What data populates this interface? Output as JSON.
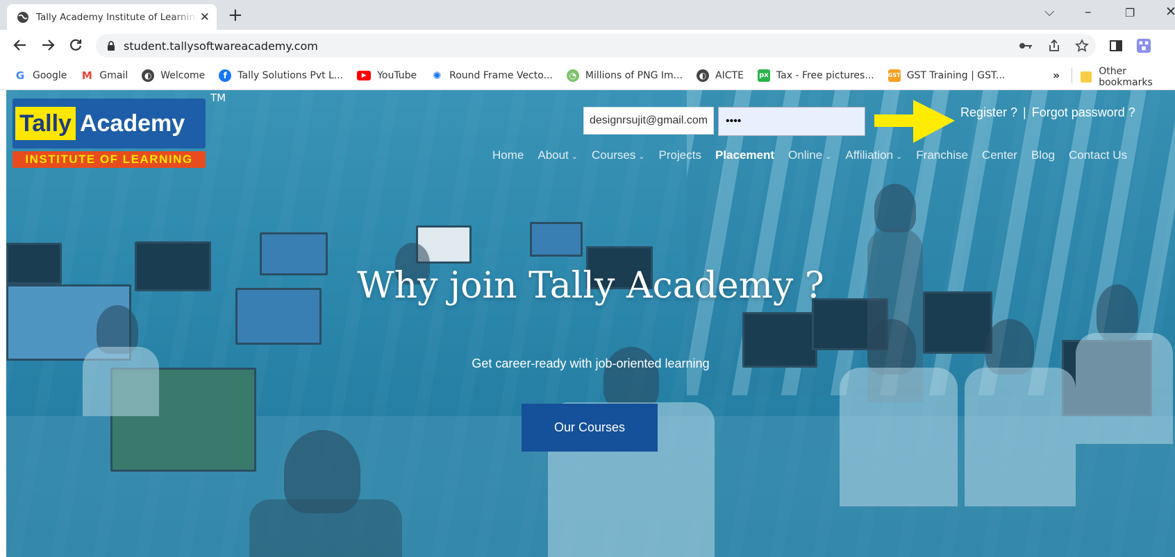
{
  "browser": {
    "tab_title": "Tally Academy Institute of Learning",
    "url": "student.tallysoftwareacademy.com",
    "bookmarks": [
      {
        "label": "Google",
        "icon": "google-icon"
      },
      {
        "label": "Gmail",
        "icon": "gmail-icon"
      },
      {
        "label": "Welcome",
        "icon": "globe-icon"
      },
      {
        "label": "Tally Solutions Pvt L...",
        "icon": "facebook-icon"
      },
      {
        "label": "YouTube",
        "icon": "youtube-icon"
      },
      {
        "label": "Round Frame Vecto...",
        "icon": "vector-icon"
      },
      {
        "label": "Millions of PNG Im...",
        "icon": "png-icon"
      },
      {
        "label": "AICTE",
        "icon": "globe-icon"
      },
      {
        "label": "Tax - Free pictures...",
        "icon": "px-icon"
      },
      {
        "label": "GST Training | GST...",
        "icon": "gst-icon"
      }
    ],
    "more_bookmarks": "»",
    "other_bookmarks": "Other bookmarks"
  },
  "site": {
    "logo": {
      "tally": "Tally",
      "academy": "Academy",
      "subtitle": "INSTITUTE OF LEARNING",
      "tm": "TM"
    },
    "login": {
      "email_value": "designrsujit@gmail.com",
      "password_value": "••••"
    },
    "auth_links": {
      "register": "Register ?",
      "separator": "|",
      "forgot": "Forgot password ?"
    },
    "nav": [
      {
        "label": "Home",
        "dropdown": false
      },
      {
        "label": "About",
        "dropdown": true
      },
      {
        "label": "Courses",
        "dropdown": true
      },
      {
        "label": "Projects",
        "dropdown": false
      },
      {
        "label": "Placement",
        "dropdown": false,
        "active": true
      },
      {
        "label": "Online",
        "dropdown": true
      },
      {
        "label": "Affiliation",
        "dropdown": true
      },
      {
        "label": "Franchise",
        "dropdown": false
      },
      {
        "label": "Center",
        "dropdown": false
      },
      {
        "label": "Blog",
        "dropdown": false
      },
      {
        "label": "Contact Us",
        "dropdown": false
      }
    ],
    "hero": {
      "headline": "Why join Tally Academy ?",
      "tagline": "Get career-ready with job-oriented learning",
      "cta": "Our Courses"
    }
  },
  "colors": {
    "accent_arrow": "#ffec00",
    "cta_bg": "#15509a",
    "logo_blue": "#1e5ea8",
    "logo_yellow": "#ffe600",
    "logo_orange": "#e84c1e"
  }
}
